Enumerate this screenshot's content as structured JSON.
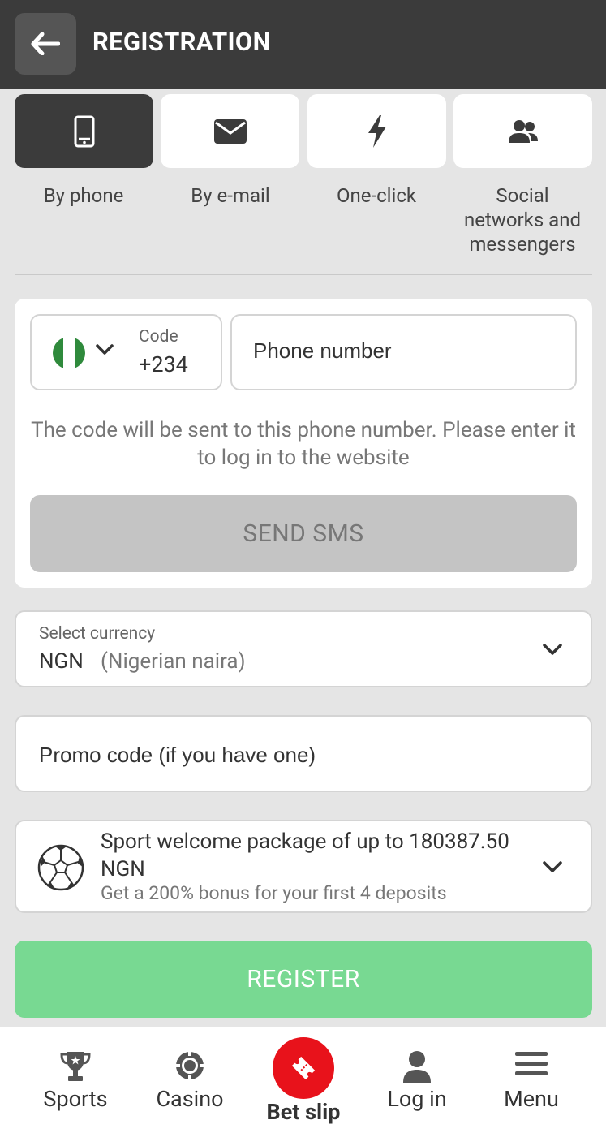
{
  "header": {
    "title": "REGISTRATION"
  },
  "methods": [
    {
      "label": "By phone",
      "icon": "phone-icon",
      "active": true
    },
    {
      "label": "By e-mail",
      "icon": "email-icon",
      "active": false
    },
    {
      "label": "One-click",
      "icon": "lightning-icon",
      "active": false
    },
    {
      "label": "Social networks and messengers",
      "icon": "users-icon",
      "active": false
    }
  ],
  "phone_form": {
    "code_label": "Code",
    "code_value": "+234",
    "phone_placeholder": "Phone number",
    "hint": "The code will be sent to this phone number. Please enter it to log in to the website",
    "send_sms": "SEND SMS"
  },
  "currency": {
    "label": "Select currency",
    "code": "NGN",
    "name": "(Nigerian naira)"
  },
  "promo": {
    "placeholder": "Promo code (if you have one)"
  },
  "bonus": {
    "title": "Sport welcome package of up to 180387.50 NGN",
    "subtitle": "Get a 200% bonus for your first 4 deposits"
  },
  "register": {
    "label": "REGISTER"
  },
  "nav": {
    "sports": "Sports",
    "casino": "Casino",
    "bet_slip": "Bet slip",
    "log_in": "Log in",
    "menu": "Menu"
  },
  "colors": {
    "header_bg": "#3b3b3b",
    "register_green": "#78d992",
    "bet_slip_red": "#e8121b"
  }
}
